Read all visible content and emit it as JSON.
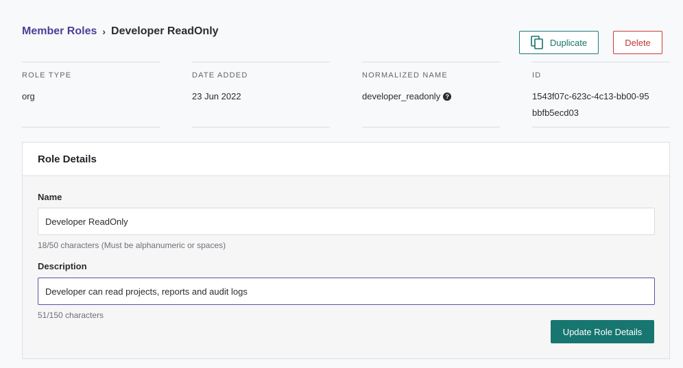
{
  "breadcrumb": {
    "parent": "Member Roles",
    "separator": "›",
    "current": "Developer ReadOnly"
  },
  "actions": {
    "duplicate_label": "Duplicate",
    "delete_label": "Delete"
  },
  "meta": [
    {
      "label": "ROLE TYPE",
      "value": "org"
    },
    {
      "label": "DATE ADDED",
      "value": "23 Jun 2022"
    },
    {
      "label": "NORMALIZED NAME",
      "value": "developer_readonly"
    },
    {
      "label": "ID",
      "value": "1543f07c-623c-4c13-bb00-95bbfb5ecd03"
    }
  ],
  "help_glyph": "?",
  "role_details": {
    "title": "Role Details",
    "name_label": "Name",
    "name_value": "Developer ReadOnly",
    "name_hint": "18/50 characters (Must be alphanumeric or spaces)",
    "description_label": "Description",
    "description_value": "Developer can read projects, reports and audit logs",
    "description_hint": "51/150 characters",
    "update_label": "Update Role Details"
  },
  "colors": {
    "accent_teal": "#17766f",
    "link_purple": "#4b3f96",
    "danger_red": "#c03434"
  }
}
